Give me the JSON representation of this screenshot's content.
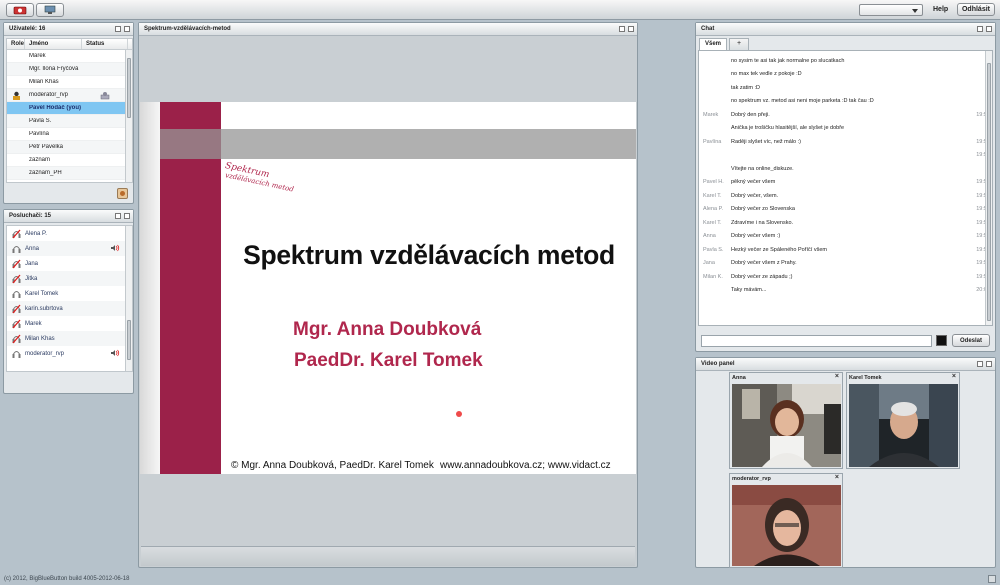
{
  "toolbar": {
    "help_label": "Help",
    "logout_label": "Odhlásit",
    "icons": [
      "camera-share-icon",
      "desktop-share-icon"
    ]
  },
  "users_panel": {
    "title": "Uživatelé: 16",
    "columns": [
      "Role",
      "Jméno",
      "Status"
    ],
    "rows": [
      {
        "name": "Marek",
        "role_icon": "",
        "status_icon": ""
      },
      {
        "name": "Mgr. Ilona Fryčová",
        "role_icon": "",
        "status_icon": ""
      },
      {
        "name": "Milan Khas",
        "role_icon": "",
        "status_icon": ""
      },
      {
        "name": "moderator_rvp",
        "role_icon": "moderator-icon",
        "status_icon": "presenter-icon"
      },
      {
        "name": "Pavel Hodáč (you)",
        "role_icon": "",
        "status_icon": "",
        "selected": true
      },
      {
        "name": "Pavla S.",
        "role_icon": "",
        "status_icon": ""
      },
      {
        "name": "Pavlína",
        "role_icon": "",
        "status_icon": ""
      },
      {
        "name": "Petr Pavelka",
        "role_icon": "",
        "status_icon": ""
      },
      {
        "name": "zaznam",
        "role_icon": "",
        "status_icon": ""
      },
      {
        "name": "zaznam_PH",
        "role_icon": "",
        "status_icon": ""
      }
    ]
  },
  "listeners_panel": {
    "title": "Posluchači: 15",
    "rows": [
      {
        "name": "Alena P.",
        "muted": true,
        "talking": false
      },
      {
        "name": "Anna",
        "muted": false,
        "talking": true
      },
      {
        "name": "Jana",
        "muted": true,
        "talking": false
      },
      {
        "name": "Jitka",
        "muted": true,
        "talking": false
      },
      {
        "name": "Karel Tomek",
        "muted": false,
        "talking": false
      },
      {
        "name": "karin.subrtova",
        "muted": true,
        "talking": false
      },
      {
        "name": "Marek",
        "muted": true,
        "talking": false
      },
      {
        "name": "Milan Khas",
        "muted": true,
        "talking": false
      },
      {
        "name": "moderator_rvp",
        "muted": false,
        "talking": true
      }
    ]
  },
  "presentation": {
    "title": "Spektrum-vzdělávacích-metod",
    "slide_title": "Spektrum vzdělávacích metod",
    "logo_line1": "Spektrum",
    "logo_line2": "vzdělávacích metod",
    "author1": "Mgr. Anna Doubková",
    "author2": "PaedDr. Karel Tomek",
    "footer_left": "© Mgr. Anna Doubková, PaedDr. Karel Tomek",
    "footer_right": "www.annadoubkova.cz; www.vidact.cz",
    "accent_color": "#9b2149"
  },
  "chat": {
    "title": "Chat",
    "tabs": [
      "Všem",
      "+"
    ],
    "messages": [
      {
        "who": "",
        "text": "no sysim te asi tak jak normalne po slucatkach",
        "time": ""
      },
      {
        "who": "",
        "text": "no max tek vedle z pokoje :D",
        "time": ""
      },
      {
        "who": "",
        "text": "tak zatim :D",
        "time": ""
      },
      {
        "who": "",
        "text": "no spektrum vz. metod asi neni moje parketa :D tak čau :D",
        "time": ""
      },
      {
        "who": "Marek",
        "text": "Dobrý den přeji.",
        "time": "19:54"
      },
      {
        "who": "",
        "text": "Anička je trošičku hlasitější, ale slyšet je dobře",
        "time": ""
      },
      {
        "who": "Pavlína",
        "text": "Raději slyšet víc, než málo :)",
        "time": "19:54"
      },
      {
        "who": "",
        "text": "",
        "time": "19:54"
      },
      {
        "who": "",
        "text": "Vítejte na online_diskuze.",
        "time": ""
      },
      {
        "who": "Pavel H.",
        "text": "pěkný večer všem",
        "time": "19:54"
      },
      {
        "who": "Karel T.",
        "text": "Dobrý večer, všem.",
        "time": "19:55"
      },
      {
        "who": "Alena P.",
        "text": "Dobrý večer zo Slovenska",
        "time": "19:55"
      },
      {
        "who": "Karel T.",
        "text": "Zdravíme i na Slovensko.",
        "time": "19:55"
      },
      {
        "who": "Anna",
        "text": "Dobrý večer všem :)",
        "time": "19:55"
      },
      {
        "who": "Pavla S.",
        "text": "Hezký večer ze Spáleného Poříčí všem",
        "time": "19:55"
      },
      {
        "who": "Jana",
        "text": "Dobrý večer všem z Prahy.",
        "time": "19:57"
      },
      {
        "who": "Milan K.",
        "text": "Dobrý večer ze západu ;)",
        "time": "19:59"
      },
      {
        "who": "",
        "text": "Taky mávám...",
        "time": "20:00"
      }
    ],
    "input_value": "",
    "send_label": "Odeslat"
  },
  "video_panel": {
    "title": "Video panel",
    "windows": [
      {
        "name": "Anna"
      },
      {
        "name": "Karel Tomek"
      },
      {
        "name": "moderator_rvp"
      }
    ]
  },
  "footer": {
    "text": "(c) 2012, BigBlueButton build 4005-2012-06-18"
  }
}
